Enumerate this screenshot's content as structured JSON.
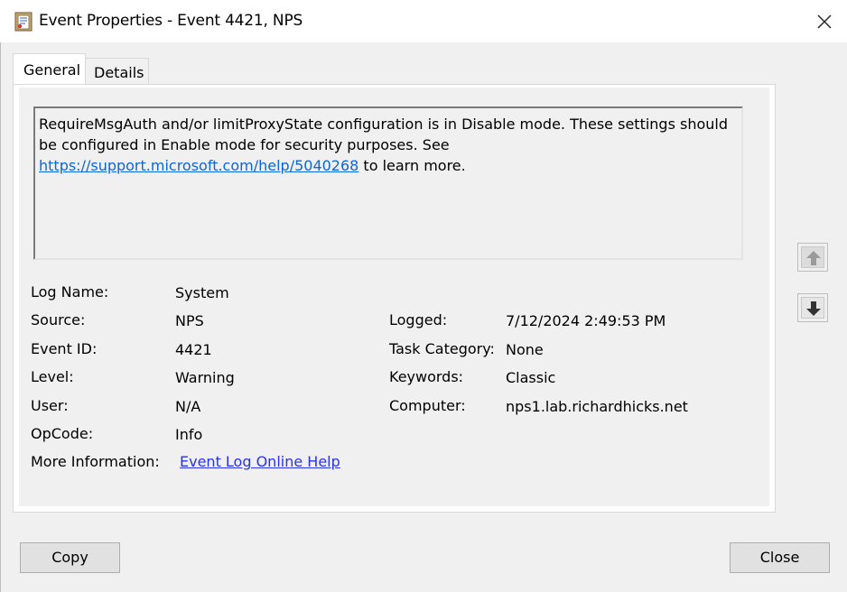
{
  "window": {
    "title": "Event Properties - Event 4421, NPS",
    "icon": "event-viewer-icon"
  },
  "tabs": [
    {
      "label": "General",
      "selected": true
    },
    {
      "label": "Details",
      "selected": false
    }
  ],
  "description": {
    "text_before": "RequireMsgAuth and/or limitProxyState configuration is in Disable mode. These settings should be configured in Enable mode for security purposes. See",
    "link": "https://support.microsoft.com/help/5040268",
    "text_after": " to learn more."
  },
  "fields": {
    "log_name": {
      "label": "Log Name:",
      "value": "System"
    },
    "source": {
      "label": "Source:",
      "value": "NPS"
    },
    "event_id": {
      "label": "Event ID:",
      "value": "4421"
    },
    "level": {
      "label": "Level:",
      "value": "Warning"
    },
    "user": {
      "label": "User:",
      "value": "N/A"
    },
    "opcode": {
      "label": "OpCode:",
      "value": "Info"
    },
    "more_info": {
      "label": "More Information:",
      "value": "Event Log Online Help"
    },
    "logged": {
      "label": "Logged:",
      "value": "7/12/2024 2:49:53 PM"
    },
    "task_category": {
      "label": "Task Category:",
      "value": "None"
    },
    "keywords": {
      "label": "Keywords:",
      "value": "Classic"
    },
    "computer": {
      "label": "Computer:",
      "value": "nps1.lab.richardhicks.net"
    }
  },
  "buttons": {
    "copy": "Copy",
    "close": "Close"
  },
  "colors": {
    "link": "#0b66d8",
    "window_bg": "#f0f0f0",
    "titlebar_bg": "#ffffff"
  }
}
